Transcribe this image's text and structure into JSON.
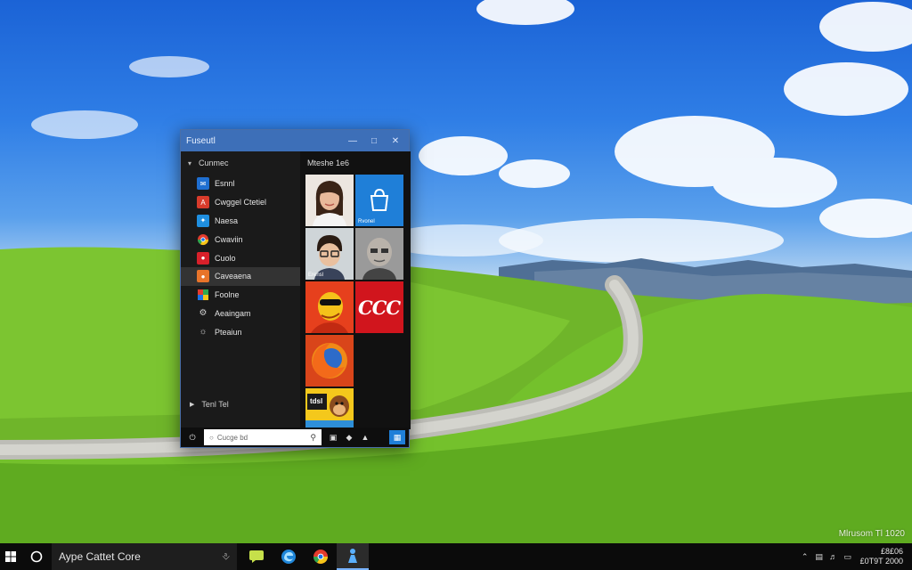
{
  "window": {
    "title": "Fuseutl",
    "minimize_icon": "minimize-icon",
    "maximize_icon": "maximize-icon",
    "close_icon": "close-icon"
  },
  "left_pane": {
    "header": "Cunmec",
    "items": [
      {
        "label": "Esnnl",
        "icon_color": "#1f6fd1",
        "icon": "mail-icon"
      },
      {
        "label": "Cwggel Ctetiel",
        "icon_color": "#d83b2b",
        "icon": "acrobat-icon"
      },
      {
        "label": "Naesa",
        "icon_color": "#1f6fd1",
        "icon": "twitter-icon"
      },
      {
        "label": "Cwaviin",
        "icon_color": "#2b2b2b",
        "icon": "chrome-icon"
      },
      {
        "label": "Cuolo",
        "icon_color": "#d8202a",
        "icon": "red-app-icon"
      },
      {
        "label": "Caveaena",
        "icon_color": "#e8742a",
        "icon": "orange-app-icon"
      },
      {
        "label": "Foolne",
        "icon_color": "#2b2b2b",
        "icon": "multicolor-app-icon"
      },
      {
        "label": "Aeaingam",
        "icon_color": "#2b2b2b",
        "icon": "gear-icon"
      },
      {
        "label": "Pteaiun",
        "icon_color": "#2b2b2b",
        "icon": "settings-icon"
      }
    ],
    "active_index": 5,
    "footer": "Tenl Tel"
  },
  "right_pane": {
    "header": "Mteshe 1e6",
    "tiles": [
      {
        "name": "person-woman-tile",
        "label": ""
      },
      {
        "name": "store-tile",
        "label": "Rvonel"
      },
      {
        "name": "person-man-glasses-tile",
        "label": "Erensl"
      },
      {
        "name": "person-bald-tile",
        "label": ""
      },
      {
        "name": "cartoon-sunglasses-tile",
        "label": ""
      },
      {
        "name": "coca-cola-tile",
        "label": "CCC"
      },
      {
        "name": "firefox-tile",
        "label": ""
      },
      {
        "name": "cartoon-monkey-tile",
        "label": "tdsl"
      }
    ]
  },
  "bottom_bar": {
    "search_text": "Cucge bd",
    "icons": [
      "power-icon",
      "search-icon",
      "window-icon",
      "bag-icon",
      "recycle-icon",
      "tile-icon"
    ]
  },
  "taskbar": {
    "search_text": "Aype Cattet Core",
    "apps": [
      {
        "name": "taskbar-messages-app",
        "icon": "chat-icon"
      },
      {
        "name": "taskbar-edge-app",
        "icon": "edge-icon"
      },
      {
        "name": "taskbar-chrome-app",
        "icon": "chrome-icon"
      },
      {
        "name": "taskbar-pinned-app",
        "icon": "person-icon",
        "active": true
      }
    ],
    "clock_line1": "£8£06",
    "clock_line2": "£0T9T 2000"
  },
  "watermark": "Mlrusom Tl 1020",
  "colors": {
    "accent": "#3d6fb8",
    "tile_blue": "#1f7fd8",
    "taskbar": "#0b0b0b"
  }
}
